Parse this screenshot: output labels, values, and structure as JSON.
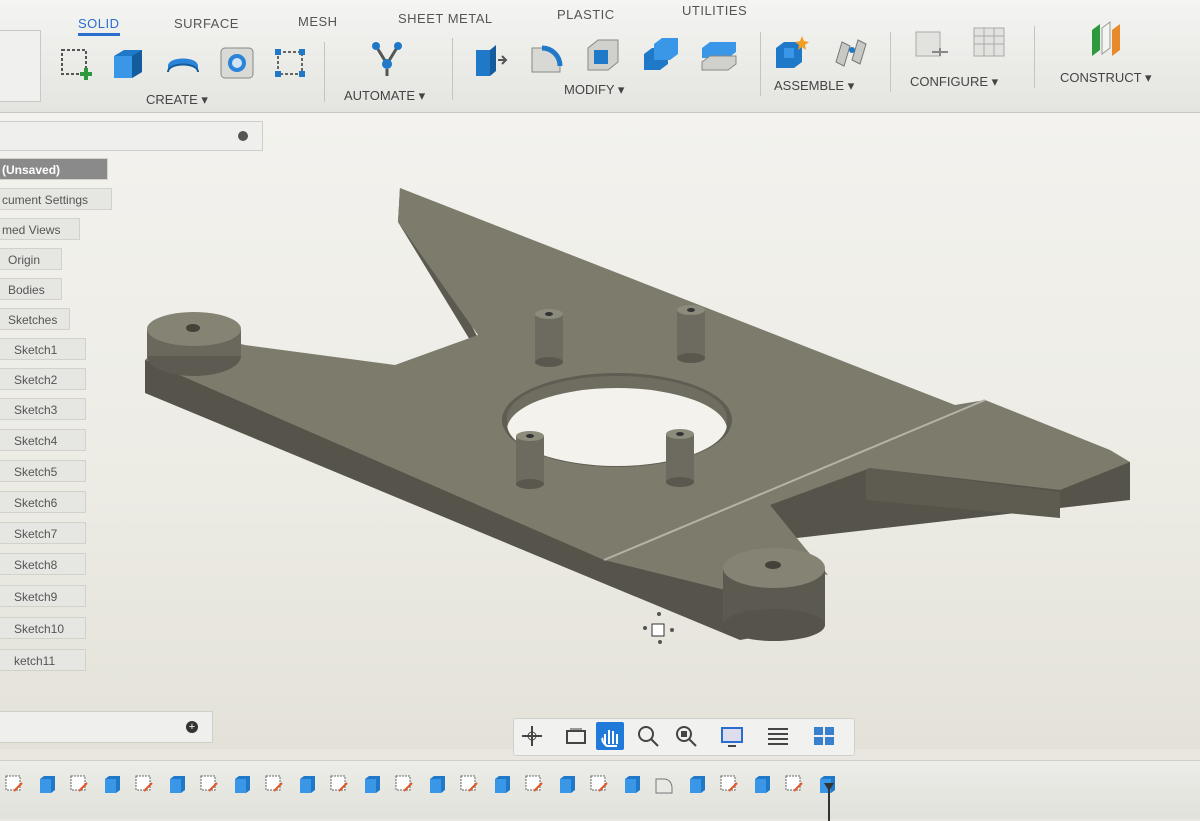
{
  "tabs": [
    {
      "label": "SOLID",
      "active": true
    },
    {
      "label": "SURFACE",
      "active": false
    },
    {
      "label": "MESH",
      "active": false
    },
    {
      "label": "SHEET METAL",
      "active": false
    },
    {
      "label": "PLASTIC",
      "active": false
    },
    {
      "label": "UTILITIES",
      "active": false
    }
  ],
  "ribbon": {
    "create": "CREATE ▾",
    "automate": "AUTOMATE ▾",
    "modify": "MODIFY ▾",
    "assemble": "ASSEMBLE ▾",
    "configure": "CONFIGURE ▾",
    "construct": "CONSTRUCT ▾"
  },
  "browser": {
    "nodes": [
      "(Unsaved)",
      "cument Settings",
      "med Views",
      "Origin",
      "Bodies",
      "Sketches",
      "Sketch1",
      "Sketch2",
      "Sketch3",
      "Sketch4",
      "Sketch5",
      "Sketch6",
      "Sketch7",
      "Sketch8",
      "Sketch9",
      "Sketch10",
      "ketch11"
    ]
  },
  "model": {
    "color": "#7d7b6c"
  },
  "colors": {
    "accent": "#2a6fd0",
    "pan_active": "#1f7ad9"
  },
  "icons": [
    "sketch-icon",
    "extrude-icon",
    "revolve-icon",
    "hole-icon",
    "rectangular-pattern-icon",
    "automate-icon",
    "press-pull-icon",
    "fillet-icon",
    "shell-icon",
    "combine-icon",
    "align-icon",
    "new-component-icon",
    "joint-icon",
    "configure-icon",
    "table-icon",
    "offset-plane-icon"
  ]
}
